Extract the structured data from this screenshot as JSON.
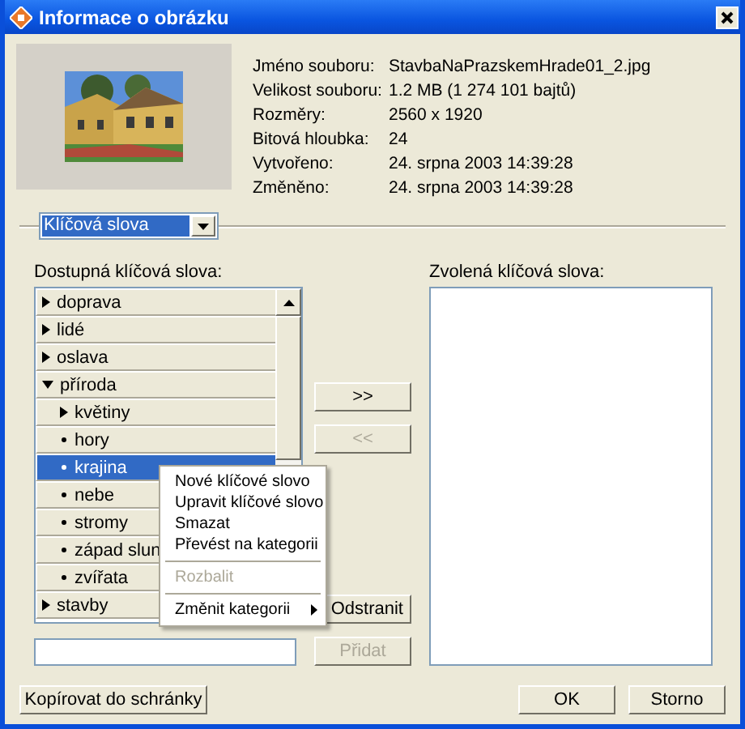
{
  "window": {
    "title": "Informace o obrázku"
  },
  "info": [
    {
      "label": "Jméno souboru:",
      "value": "StavbaNaPrazskemHrade01_2.jpg"
    },
    {
      "label": "Velikost souboru:",
      "value": "1.2 MB (1 274 101 bajtů)"
    },
    {
      "label": "Rozměry:",
      "value": "2560 x 1920"
    },
    {
      "label": "Bitová hloubka:",
      "value": "24"
    },
    {
      "label": "Vytvořeno:",
      "value": "24. srpna 2003 14:39:28"
    },
    {
      "label": "Změněno:",
      "value": "24. srpna 2003 14:39:28"
    }
  ],
  "section_combo": {
    "value": "Klíčová slova",
    "highlighted": true
  },
  "available": {
    "label": "Dostupná klíčová slova:",
    "items": [
      {
        "label": "doprava",
        "kind": "category",
        "expanded": false,
        "selected": false
      },
      {
        "label": "lidé",
        "kind": "category",
        "expanded": false,
        "selected": false
      },
      {
        "label": "oslava",
        "kind": "category",
        "expanded": false,
        "selected": false
      },
      {
        "label": "příroda",
        "kind": "category",
        "expanded": true,
        "selected": false,
        "children": [
          {
            "label": "květiny",
            "kind": "category",
            "expanded": false,
            "selected": false
          },
          {
            "label": "hory",
            "kind": "keyword",
            "selected": false
          },
          {
            "label": "krajina",
            "kind": "keyword",
            "selected": true
          },
          {
            "label": "nebe",
            "kind": "keyword",
            "selected": false
          },
          {
            "label": "stromy",
            "kind": "keyword",
            "selected": false
          },
          {
            "label": "západ slun",
            "kind": "keyword",
            "selected": false
          },
          {
            "label": "zvířata",
            "kind": "keyword",
            "selected": false
          }
        ]
      },
      {
        "label": "stavby",
        "kind": "category",
        "expanded": false,
        "selected": false
      }
    ]
  },
  "move_buttons": [
    {
      "label": ">>",
      "disabled": false
    },
    {
      "label": "<<",
      "disabled": true
    }
  ],
  "edit_buttons": [
    {
      "label": "Odstranit",
      "disabled": false
    },
    {
      "label": "Přidat",
      "disabled": true
    }
  ],
  "chosen": {
    "label": "Zvolená klíčová slova:"
  },
  "context_menu": [
    {
      "kind": "item",
      "label": "Nové klíčové slovo",
      "disabled": false
    },
    {
      "kind": "item",
      "label": "Upravit klíčové slovo",
      "disabled": false
    },
    {
      "kind": "item",
      "label": "Smazat",
      "disabled": false
    },
    {
      "kind": "item",
      "label": "Převést na kategorii",
      "disabled": false
    },
    {
      "kind": "separator"
    },
    {
      "kind": "item",
      "label": "Rozbalit",
      "disabled": true
    },
    {
      "kind": "separator"
    },
    {
      "kind": "submenu",
      "label": "Změnit kategorii",
      "disabled": false
    }
  ],
  "copy_button": "Kopírovat do schránky",
  "dialog_buttons": [
    "OK",
    "Storno"
  ]
}
